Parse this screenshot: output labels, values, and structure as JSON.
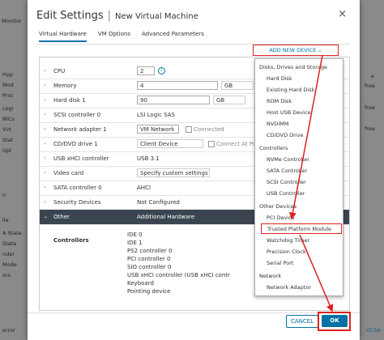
{
  "background": {
    "top_left": "Monitor",
    "left_labels": [
      "Hyp",
      "Mod",
      "Proc",
      "Logi",
      "NICs",
      "Virt",
      "Stat",
      "Upt",
      "n",
      "ile",
      "A State",
      "State",
      "nder",
      "Mode",
      "ors"
    ],
    "right_labels": [
      "e",
      "free",
      "free",
      "free"
    ],
    "bottom_left": "error",
    "bottom_right": "VCSA"
  },
  "dialog": {
    "title": "Edit Settings",
    "vm_name": "New Virtual Machine",
    "close": "×",
    "tabs": [
      "Virtual Hardware",
      "VM Options",
      "Advanced Parameters"
    ]
  },
  "add_device": {
    "label": "ADD NEW DEVICE ⌄"
  },
  "hardware": {
    "cpu": {
      "label": "CPU",
      "value": "2"
    },
    "memory": {
      "label": "Memory",
      "value": "4",
      "unit": "GB"
    },
    "hard_disk": {
      "label": "Hard disk 1",
      "value": "90",
      "unit": "GB"
    },
    "scsi": {
      "label": "SCSI controller 0",
      "value": "LSI Logic SAS"
    },
    "network": {
      "label": "Network adapter 1",
      "value": "VM Network",
      "extra": "Connected"
    },
    "cdvd": {
      "label": "CD/DVD drive 1",
      "value": "Client Device",
      "extra": "Connect At Powe"
    },
    "usb": {
      "label": "USB xHCI controller",
      "value": "USB 3.1"
    },
    "video": {
      "label": "Video card",
      "value": "Specify custom settings"
    },
    "sata": {
      "label": "SATA controller 0",
      "value": "AHCI"
    },
    "security": {
      "label": "Security Devices",
      "value": "Not Configured"
    },
    "other": {
      "label": "Other",
      "value": "Additional Hardware"
    },
    "controllers_label": "Controllers",
    "controllers": [
      "IDE 0",
      "IDE 1",
      "PS2 controller 0",
      "PCI controller 0",
      "SIO controller 0",
      "USB xHCI controller (USB xHCI contr",
      "Keyboard",
      "Pointing device"
    ]
  },
  "menu": {
    "items": [
      {
        "type": "head",
        "text": "Disks, Drives and Storage"
      },
      {
        "type": "item",
        "text": "Hard Disk"
      },
      {
        "type": "item",
        "text": "Existing Hard Disk"
      },
      {
        "type": "item",
        "text": "RDM Disk"
      },
      {
        "type": "item",
        "text": "Host USB Device"
      },
      {
        "type": "item",
        "text": "NVDIMM"
      },
      {
        "type": "item",
        "text": "CD/DVD Drive"
      },
      {
        "type": "head",
        "text": "Controllers"
      },
      {
        "type": "item",
        "text": "NVMe Controller"
      },
      {
        "type": "item",
        "text": "SATA Controller"
      },
      {
        "type": "item",
        "text": "SCSI Controller"
      },
      {
        "type": "item",
        "text": "USB Controller"
      },
      {
        "type": "head",
        "text": "Other Devices"
      },
      {
        "type": "item",
        "text": "PCI Device"
      },
      {
        "type": "item",
        "text": "Trusted Platform Module"
      },
      {
        "type": "item",
        "text": "Watchdog Timer"
      },
      {
        "type": "item",
        "text": "Precision Clock"
      },
      {
        "type": "item",
        "text": "Serial Port"
      },
      {
        "type": "head",
        "text": "Network"
      },
      {
        "type": "item",
        "text": "Network Adaptor"
      }
    ]
  },
  "footer": {
    "cancel": "CANCEL",
    "ok": "OK"
  },
  "colors": {
    "accent": "#0072a3",
    "highlight": "#e02020"
  }
}
